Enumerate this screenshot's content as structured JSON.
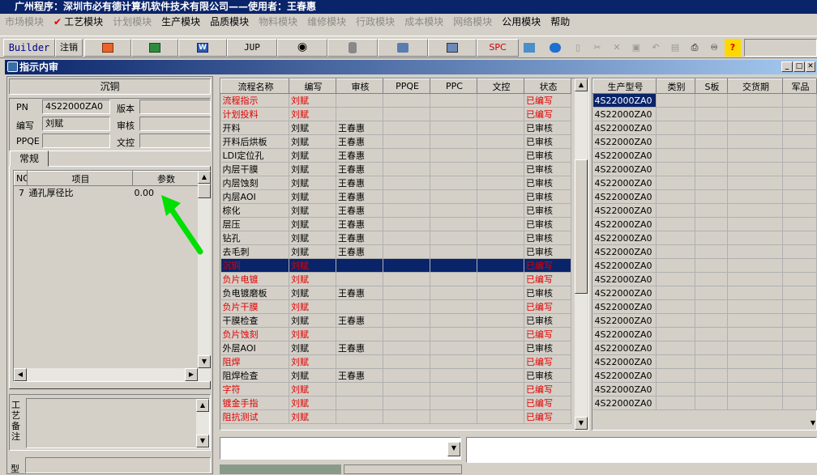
{
  "title": "广州程序：深圳市必有德计算机软件技术有限公司——使用者：王春惠",
  "menu": [
    "市场模块",
    "工艺模块",
    "计划模块",
    "生产模块",
    "品质模块",
    "物料模块",
    "维修模块",
    "行政模块",
    "成本模块",
    "网络模块",
    "公用模块",
    "帮助"
  ],
  "toolbar": {
    "builder": "Builder",
    "log": "注销",
    "jup": "JUP",
    "spc": "SPC"
  },
  "window": {
    "title": "指示内审"
  },
  "left": {
    "process": "沉铜",
    "pn_label": "PN",
    "pn": "4S22000ZA0",
    "version_label": "版本",
    "version": "",
    "writer_label": "编写",
    "writer": "刘赋",
    "review_label": "审核",
    "review": "",
    "ppqe_label": "PPQE",
    "ppqe": "",
    "dc_label": "文控",
    "dc": "",
    "tab": "常规",
    "params_headers": [
      "NO",
      "项目",
      "参数"
    ],
    "params": [
      {
        "no": "7",
        "item": "通孔厚径比",
        "value": "0.00"
      }
    ],
    "remark_label": "工艺备注",
    "type_label": "型"
  },
  "flow": {
    "headers": [
      "流程名称",
      "编写",
      "审核",
      "PPQE",
      "PPC",
      "文控",
      "状态"
    ],
    "rows": [
      {
        "name": "流程指示",
        "writer": "刘赋",
        "review": "",
        "status": "已编写",
        "red": true
      },
      {
        "name": "计划投料",
        "writer": "刘赋",
        "review": "",
        "status": "已编写",
        "red": true
      },
      {
        "name": "开料",
        "writer": "刘赋",
        "review": "王春惠",
        "status": "已审核",
        "red": false
      },
      {
        "name": "开料后烘板",
        "writer": "刘赋",
        "review": "王春惠",
        "status": "已审核",
        "red": false
      },
      {
        "name": "LDI定位孔",
        "writer": "刘赋",
        "review": "王春惠",
        "status": "已审核",
        "red": false
      },
      {
        "name": "内层干膜",
        "writer": "刘赋",
        "review": "王春惠",
        "status": "已审核",
        "red": false
      },
      {
        "name": "内层蚀刻",
        "writer": "刘赋",
        "review": "王春惠",
        "status": "已审核",
        "red": false
      },
      {
        "name": "内层AOI",
        "writer": "刘赋",
        "review": "王春惠",
        "status": "已审核",
        "red": false
      },
      {
        "name": "棕化",
        "writer": "刘赋",
        "review": "王春惠",
        "status": "已审核",
        "red": false
      },
      {
        "name": "层压",
        "writer": "刘赋",
        "review": "王春惠",
        "status": "已审核",
        "red": false
      },
      {
        "name": "钻孔",
        "writer": "刘赋",
        "review": "王春惠",
        "status": "已审核",
        "red": false
      },
      {
        "name": "去毛刺",
        "writer": "刘赋",
        "review": "王春惠",
        "status": "已审核",
        "red": false
      },
      {
        "name": "沉铜",
        "writer": "刘赋",
        "review": "",
        "status": "已编写",
        "red": true,
        "selected": true
      },
      {
        "name": "负片电镀",
        "writer": "刘赋",
        "review": "",
        "status": "已编写",
        "red": true
      },
      {
        "name": "负电镀磨板",
        "writer": "刘赋",
        "review": "王春惠",
        "status": "已审核",
        "red": false
      },
      {
        "name": "负片干膜",
        "writer": "刘赋",
        "review": "",
        "status": "已编写",
        "red": true
      },
      {
        "name": "干膜检查",
        "writer": "刘赋",
        "review": "王春惠",
        "status": "已审核",
        "red": false
      },
      {
        "name": "负片蚀刻",
        "writer": "刘赋",
        "review": "",
        "status": "已编写",
        "red": true
      },
      {
        "name": "外层AOI",
        "writer": "刘赋",
        "review": "王春惠",
        "status": "已审核",
        "red": false
      },
      {
        "name": "阻焊",
        "writer": "刘赋",
        "review": "",
        "status": "已编写",
        "red": true
      },
      {
        "name": "阻焊检查",
        "writer": "刘赋",
        "review": "王春惠",
        "status": "已审核",
        "red": false
      },
      {
        "name": "字符",
        "writer": "刘赋",
        "review": "",
        "status": "已编写",
        "red": true
      },
      {
        "name": "镀金手指",
        "writer": "刘赋",
        "review": "",
        "status": "已编写",
        "red": true
      },
      {
        "name": "阻抗测试",
        "writer": "刘赋",
        "review": "",
        "status": "已编写",
        "red": true
      }
    ]
  },
  "right": {
    "headers": [
      "生产型号",
      "类别",
      "S板",
      "交货期",
      "军品"
    ],
    "model": "4S22000ZA0",
    "row_count": 23
  }
}
